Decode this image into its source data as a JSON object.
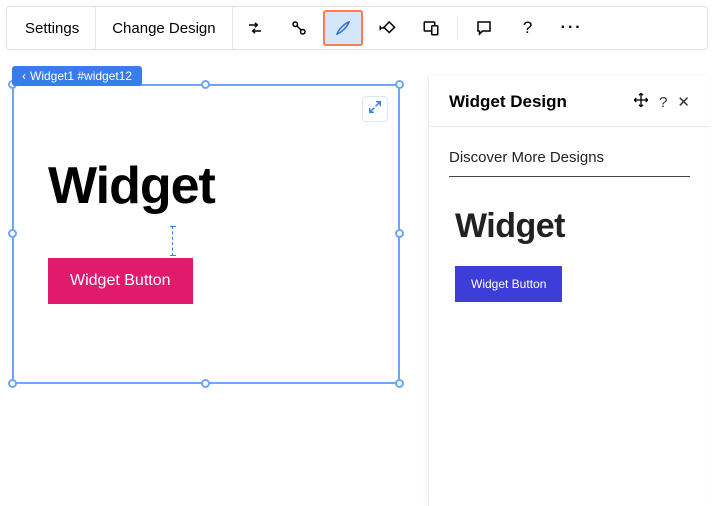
{
  "toolbar": {
    "settings_label": "Settings",
    "change_design_label": "Change Design"
  },
  "breadcrumb": {
    "text": "Widget1 #widget12"
  },
  "canvas": {
    "widget_title": "Widget",
    "widget_button_label": "Widget Button"
  },
  "panel": {
    "title": "Widget Design",
    "subtitle": "Discover More Designs",
    "preview_title": "Widget",
    "preview_button_label": "Widget Button",
    "help_glyph": "?",
    "close_glyph": "✕"
  }
}
